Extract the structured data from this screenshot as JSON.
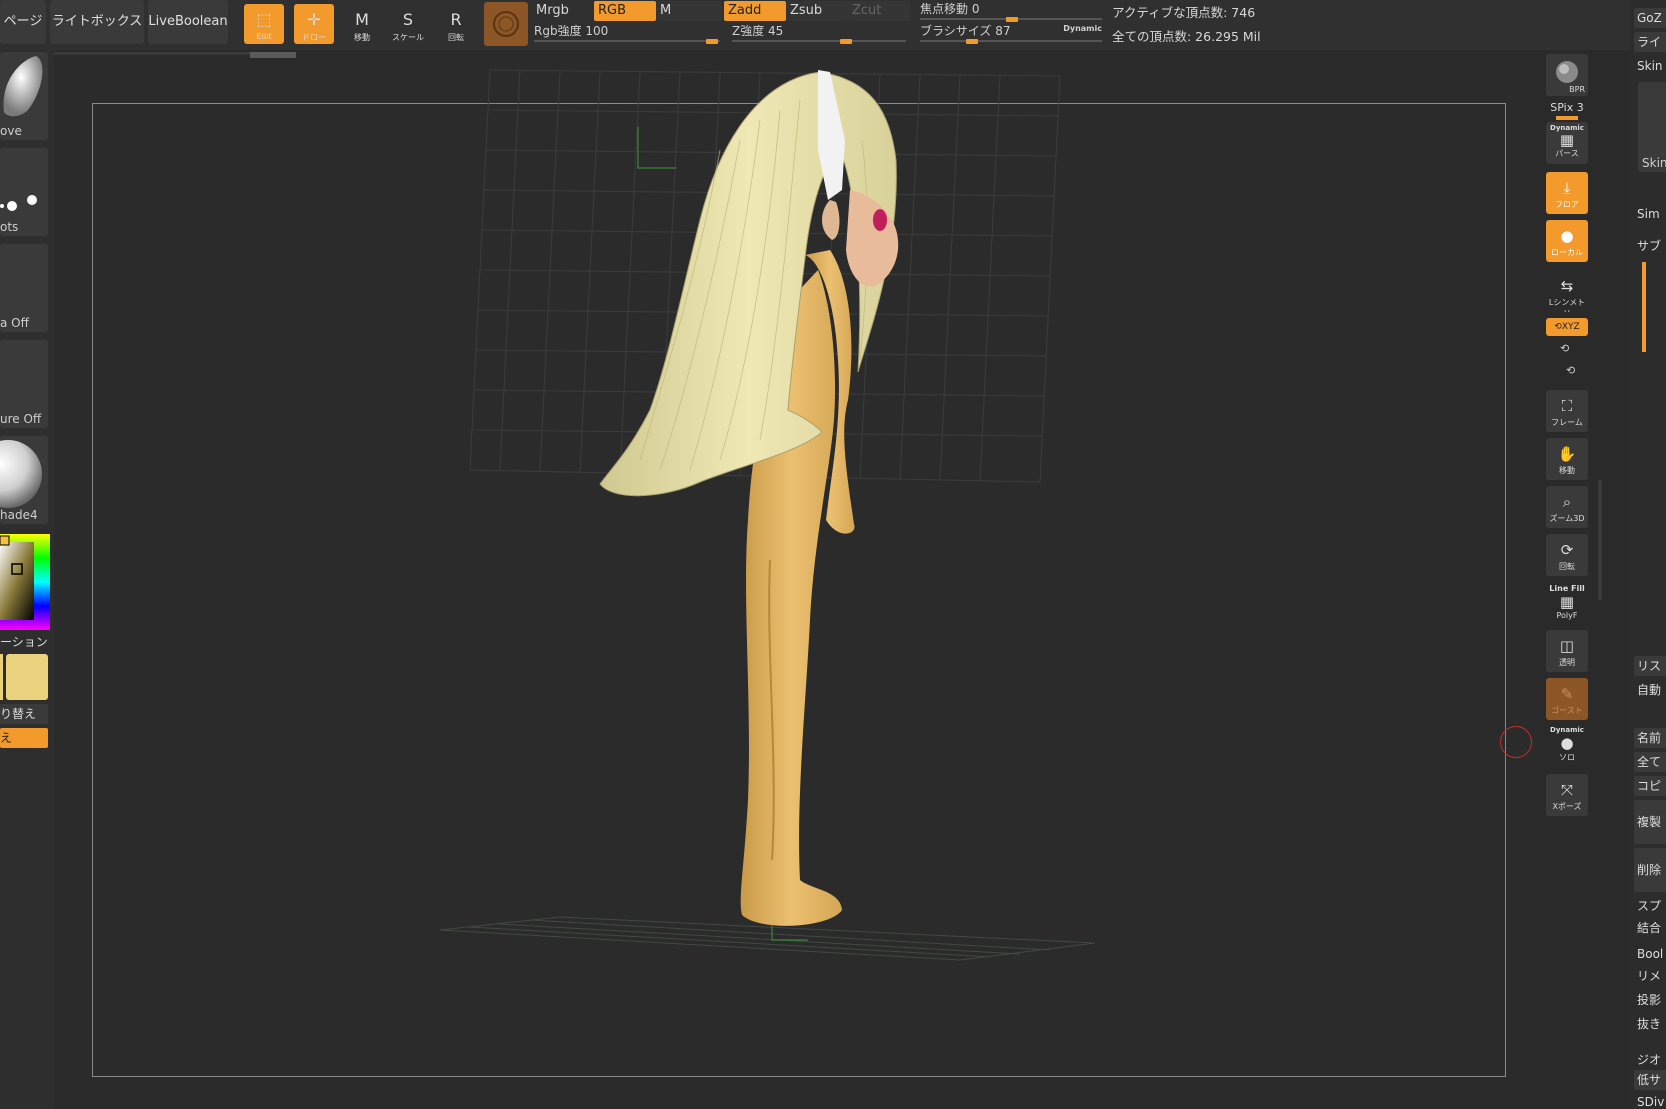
{
  "topbar": {
    "page_btn": "ページ",
    "lightbox_btn": "ライトボックス",
    "liveboolean_btn": "LiveBoolean",
    "edit_label": "Edit",
    "draw_label": "ドロー",
    "move_letter": "M",
    "move_label": "移動",
    "scale_letter": "S",
    "scale_label": "スケール",
    "rotate_letter": "R",
    "rotate_label": "回転",
    "mrgb": "Mrgb",
    "rgb": "RGB",
    "m": "M",
    "zadd": "Zadd",
    "zsub": "Zsub",
    "zcut": "Zcut",
    "rgb_intensity": "Rgb強度 100",
    "z_intensity": "Z強度 45",
    "focal_shift": "焦点移動 0",
    "brush_size": "ブラシサイズ 87",
    "dynamic": "Dynamic",
    "active_points": "アクティブな頂点数: 746",
    "total_points": "全ての頂点数: 26.295 Mil"
  },
  "leftpanel": {
    "brush_cap": "ove",
    "stroke_cap": "ots",
    "alpha_cap": "a Off",
    "texture_cap": "ure Off",
    "material_cap": "hade4",
    "gradient_cap": "ーション",
    "switch_cap": "り替え",
    "alt_cap": "え"
  },
  "righttoolbar": {
    "bpr": "BPR",
    "spix": "SPix 3",
    "dynamic": "Dynamic",
    "perspective": "パース",
    "floor": "フロア",
    "local": "ローカル",
    "lsym": "Lシンメトリ",
    "xyz": "XYZ",
    "frame": "フレーム",
    "move": "移動",
    "zoom3d": "ズーム3D",
    "rotate": "回転",
    "linefill": "Line Fill",
    "polyf": "PolyF",
    "transparent": "透明",
    "ghost": "ゴースト",
    "dynamic2": "Dynamic",
    "solo": "ソロ",
    "xpose": "Xポーズ"
  },
  "farright": {
    "goz": "GoZ",
    "light": "ライ",
    "skin": "Skin",
    "skin2": "Skin",
    "sim": "Sim",
    "sub": "サブ",
    "list": "リス",
    "auto": "自動",
    "name": "名前",
    "all": "全て",
    "copy": "コピ",
    "dup": "複製",
    "del": "削除",
    "sp": "スプ",
    "merge": "結合",
    "bool": "Bool",
    "remesh": "リメ",
    "proj": "投影",
    "extract": "抜き",
    "geo": "ジオ",
    "low": "低サ",
    "sdiv": "SDiv"
  },
  "colors": {
    "accent": "#f39a2d",
    "panel": "#3a3a3a",
    "hair": "#e7e0a6",
    "skin": "#e9bd6a"
  }
}
